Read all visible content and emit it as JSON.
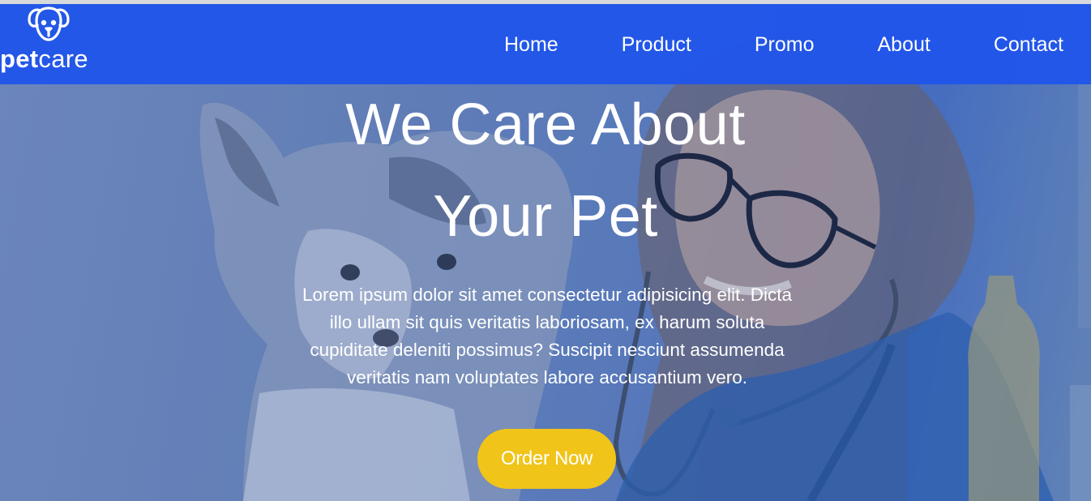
{
  "brand": {
    "name_bold": "pet",
    "name_regular": "care",
    "icon": "dog-face-icon"
  },
  "nav": {
    "items": [
      "Home",
      "Product",
      "Promo",
      "About",
      "Contact"
    ]
  },
  "hero": {
    "title_line1": "We Care About",
    "title_line2": "Your Pet",
    "description": "Lorem ipsum dolor sit amet consectetur adipisicing elit. Dicta illo ullam sit quis veritatis laboriosam, ex harum soluta cupiditate deleniti possimus? Suscipit nesciunt assumenda veritatis nam voluptates labore accusantium vero.",
    "cta_label": "Order Now"
  },
  "colors": {
    "navbar": "#2055ea",
    "cta": "#f0c419",
    "text": "#ffffff"
  }
}
